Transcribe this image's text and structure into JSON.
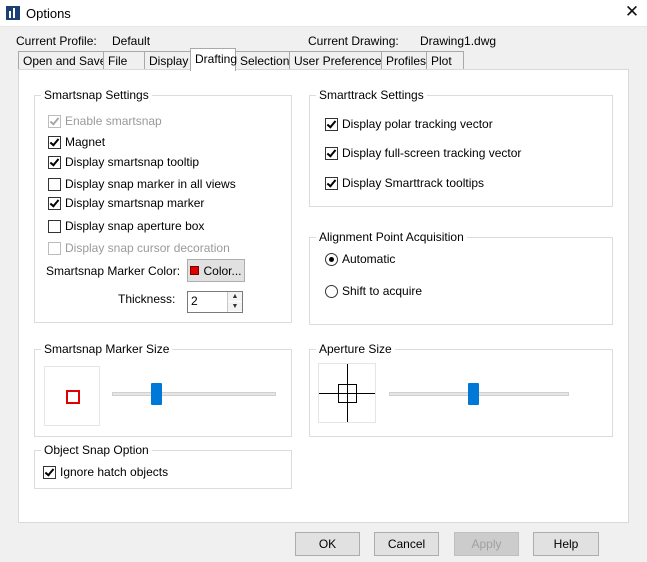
{
  "window": {
    "title": "Options",
    "close_glyph": "✕"
  },
  "header": {
    "profile_label": "Current Profile:",
    "profile_value": "Default",
    "drawing_label": "Current Drawing:",
    "drawing_value": "Drawing1.dwg"
  },
  "tabs": [
    {
      "label": "Open and Save"
    },
    {
      "label": "File"
    },
    {
      "label": "Display"
    },
    {
      "label": "Drafting",
      "active": true
    },
    {
      "label": "Selection"
    },
    {
      "label": "User Preferences"
    },
    {
      "label": "Profiles"
    },
    {
      "label": "Plot"
    }
  ],
  "smartsnap": {
    "title": "Smartsnap Settings",
    "options": [
      {
        "label": "Enable smartsnap",
        "checked": true,
        "enabled": false
      },
      {
        "label": "Magnet",
        "checked": true,
        "enabled": true
      },
      {
        "label": "Display smartsnap tooltip",
        "checked": true,
        "enabled": true
      },
      {
        "label": "Display snap marker in all views",
        "checked": false,
        "enabled": true
      },
      {
        "label": "Display smartsnap marker",
        "checked": true,
        "enabled": true
      },
      {
        "label": "Display snap aperture box",
        "checked": false,
        "enabled": true
      },
      {
        "label": "Display snap cursor decoration",
        "checked": false,
        "enabled": false
      }
    ],
    "marker_color_label": "Smartsnap Marker Color:",
    "color_button_label": "Color...",
    "marker_color": "#e00000",
    "thickness_label": "Thickness:",
    "thickness_value": "2"
  },
  "smarttrack": {
    "title": "Smarttrack Settings",
    "options": [
      {
        "label": "Display polar tracking vector",
        "checked": true
      },
      {
        "label": "Display full-screen tracking vector",
        "checked": true
      },
      {
        "label": "Display Smarttrack tooltips",
        "checked": true
      }
    ]
  },
  "alignment": {
    "title": "Alignment Point Acquisition",
    "options": [
      {
        "label": "Automatic",
        "selected": true
      },
      {
        "label": "Shift to acquire",
        "selected": false
      }
    ]
  },
  "marker_size": {
    "title": "Smartsnap Marker Size",
    "slider_value": 0.27
  },
  "aperture_size": {
    "title": "Aperture Size",
    "slider_value": 0.47
  },
  "object_snap": {
    "title": "Object Snap Option",
    "options": [
      {
        "label": "Ignore hatch objects",
        "checked": true
      }
    ]
  },
  "buttons": {
    "ok": "OK",
    "cancel": "Cancel",
    "apply": "Apply",
    "help": "Help"
  },
  "colors": {
    "accent": "#0078d7",
    "marker": "#e00000"
  }
}
